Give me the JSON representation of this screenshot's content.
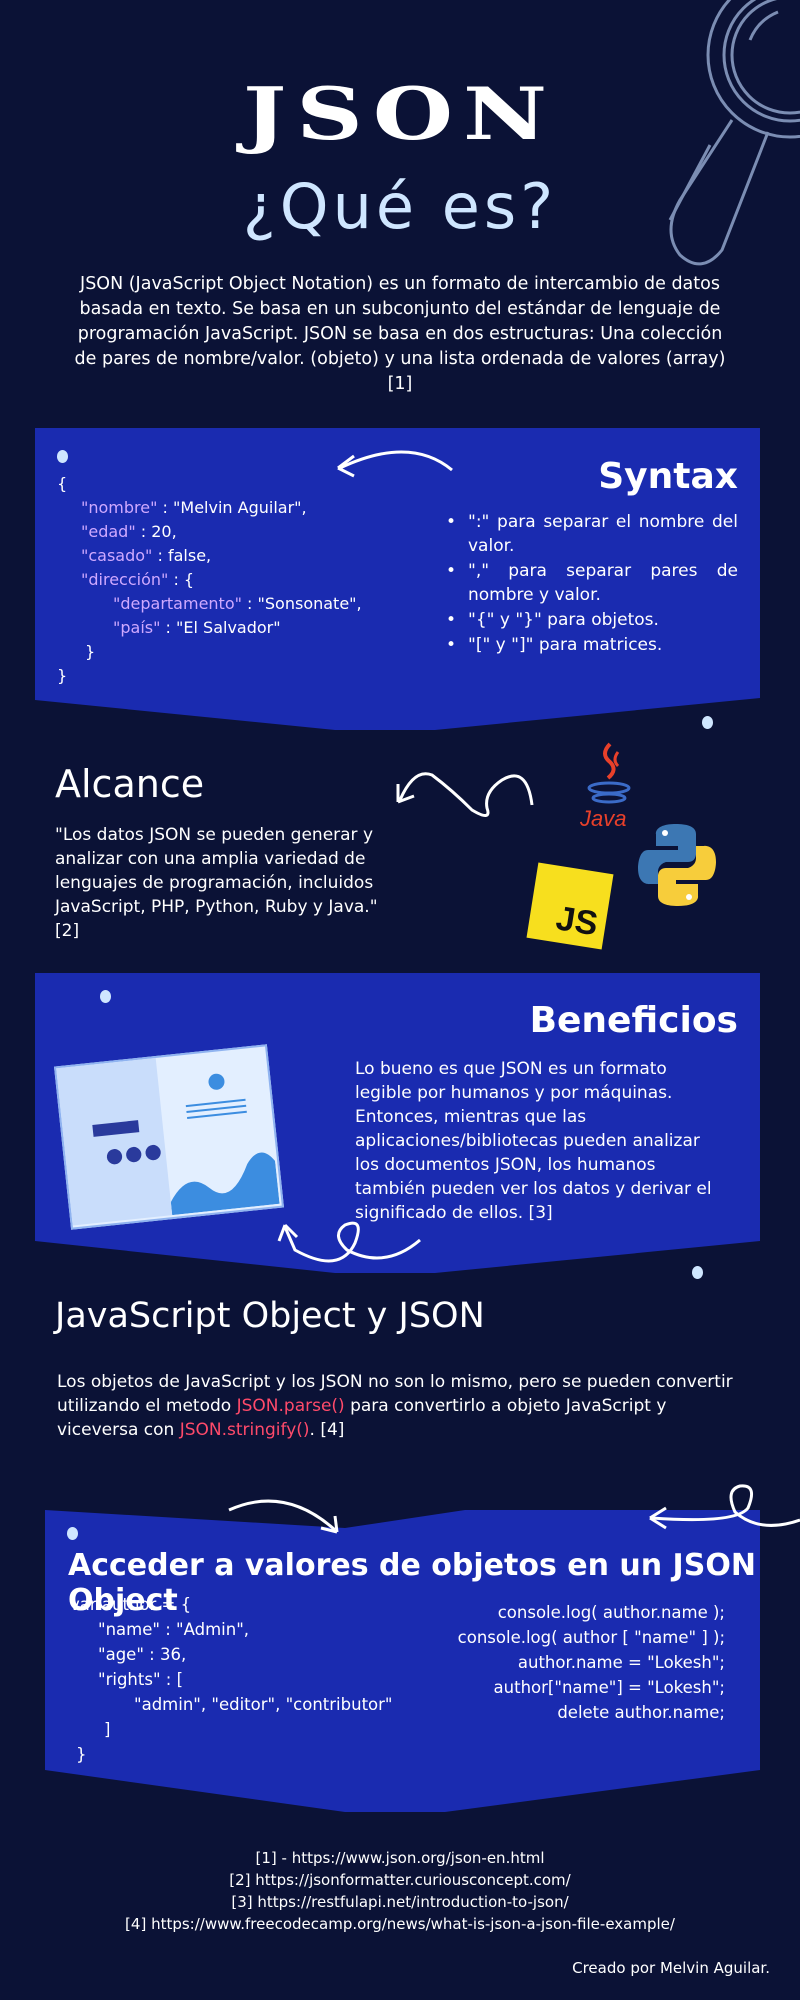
{
  "header": {
    "title": "JSON",
    "subtitle": "¿Qué es?",
    "intro": "JSON (JavaScript Object Notation) es un formato de intercambio de datos basada en texto. Se basa en un subconjunto del estándar de lenguaje de programación JavaScript. JSON se basa en dos estructuras: Una colección de pares de nombre/valor. (objeto) y una lista ordenada de valores (array) [1]"
  },
  "syntax": {
    "title": "Syntax",
    "code": {
      "open": "{",
      "k1": "\"nombre\"",
      "v1": " : \"Melvin Aguilar\",",
      "k2": "\"edad\"",
      "v2": " : 20,",
      "k3": "\"casado\"",
      "v3": " : false,",
      "k4": "\"dirección\"",
      "v4": " : {",
      "k5": "\"departamento\"",
      "v5": " : \"Sonsonate\",",
      "k6": "\"país\"",
      "v6": " : \"El Salvador\"",
      "close_inner": "}",
      "close": "}"
    },
    "bullets": [
      "\":\" para separar el nombre del valor.",
      "\",\" para separar pares de nombre y valor.",
      "\"{\" y \"}\" para objetos.",
      "\"[\" y \"]\" para matrices."
    ]
  },
  "alcance": {
    "title": "Alcance",
    "text": "\"Los datos JSON se pueden generar y analizar con una amplia variedad de lenguajes de programación, incluidos JavaScript, PHP, Python, Ruby y Java.\" [2]",
    "logos": {
      "java": "Java",
      "js": "JS"
    }
  },
  "beneficios": {
    "title": "Beneficios",
    "text": "Lo bueno es que JSON es un formato legible por humanos y por máquinas. Entonces, mientras que las aplicaciones/bibliotecas pueden analizar los documentos JSON, los humanos también pueden ver los datos y derivar el significado de ellos. [3]"
  },
  "js_object": {
    "title": "JavaScript Object y JSON",
    "text_a": "Los objetos de JavaScript y los JSON no son lo mismo, pero se pueden convertir utilizando el metodo ",
    "parse": "JSON.parse()",
    "text_b": " para convertirlo a objeto JavaScript y viceversa con ",
    "stringify": "JSON.stringify()",
    "text_c": ". [4]"
  },
  "acceder": {
    "title": "Acceder a valores de objetos en un JSON Object",
    "left": [
      "var author = {",
      "\"name\" : \"Admin\",",
      "\"age\" : 36,",
      "\"rights\" : [",
      "\"admin\", \"editor\", \"contributor\"",
      "]",
      "}"
    ],
    "right": [
      "console.log( author.name );",
      "console.log( author [ \"name\" ] );",
      "author.name = \"Lokesh\";",
      "author[\"name\"] = \"Lokesh\";",
      "delete author.name;"
    ]
  },
  "references": [
    "[1] - https://www.json.org/json-en.html",
    "[2] https://jsonformatter.curiousconcept.com/",
    "[3] https://restfulapi.net/introduction-to-json/",
    "[4] https://www.freecodecamp.org/news/what-is-json-a-json-file-example/"
  ],
  "footer": {
    "credit": "Creado por Melvin Aguilar."
  },
  "colors": {
    "background": "#0b1236",
    "panel": "#1a2bb0",
    "key_purple": "#cfa9ff",
    "method_red": "#ff4a6a",
    "subtitle": "#cfe6ff"
  }
}
